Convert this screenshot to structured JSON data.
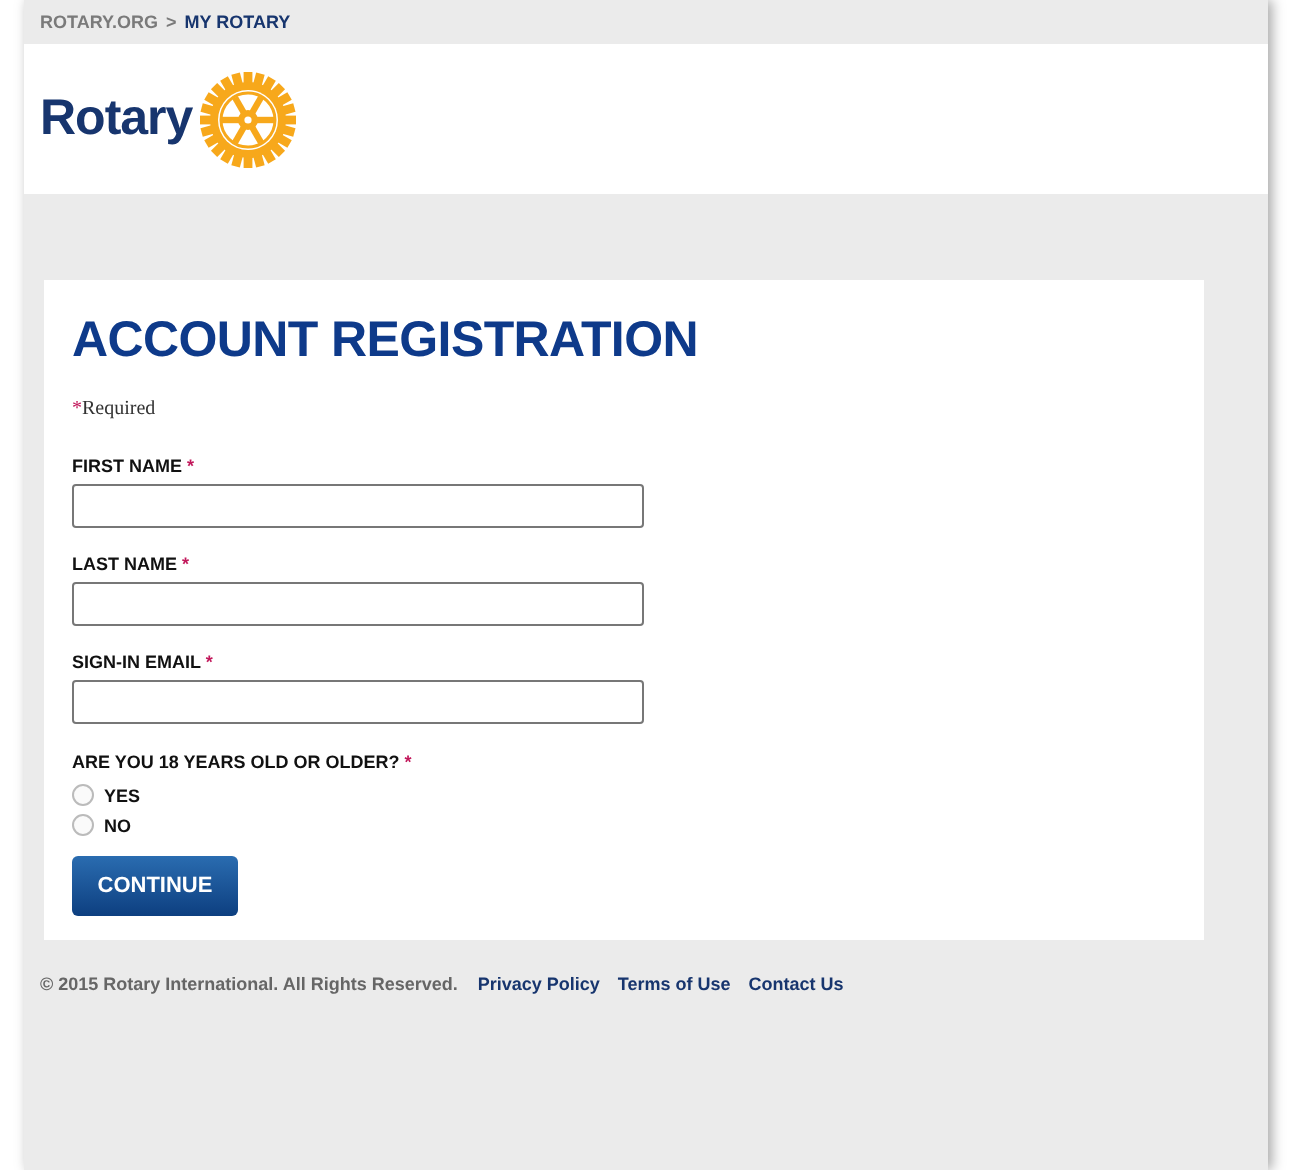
{
  "breadcrumb": [
    {
      "label": "ROTARY.ORG",
      "selected": false
    },
    {
      "label": "MY ROTARY",
      "selected": true
    }
  ],
  "breadcrumb_separator": ">",
  "logo": {
    "wordmark": "Rotary"
  },
  "form": {
    "title": "ACCOUNT REGISTRATION",
    "required_note": {
      "mark": "*",
      "text": "Required"
    },
    "fields": [
      {
        "label": "FIRST NAME",
        "required_mark": "*"
      },
      {
        "label": "LAST NAME",
        "required_mark": "*"
      },
      {
        "label": "SIGN-IN EMAIL",
        "required_mark": "*"
      }
    ],
    "age_question": {
      "label": "ARE YOU 18 YEARS OLD OR OLDER?",
      "required_mark": "*",
      "options": [
        {
          "label": "YES",
          "selected": false
        },
        {
          "label": "NO",
          "selected": false
        }
      ]
    },
    "submit": "CONTINUE"
  },
  "footer": {
    "copyright": "© 2015 Rotary International. All Rights Reserved.",
    "links": [
      "Privacy Policy",
      "Terms of Use",
      "Contact Us"
    ]
  }
}
